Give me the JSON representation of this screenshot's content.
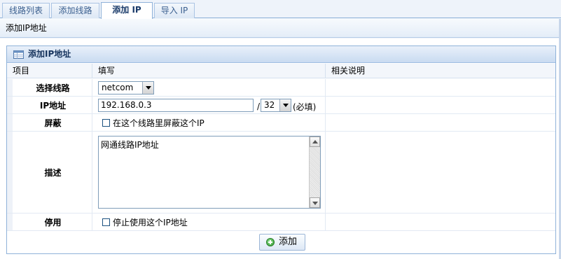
{
  "tabs": [
    {
      "label": "线路列表",
      "active": false
    },
    {
      "label": "添加线路",
      "active": false
    },
    {
      "label": "添加 IP",
      "active": true
    },
    {
      "label": "导入 IP",
      "active": false
    }
  ],
  "header": {
    "title": "添加IP地址"
  },
  "panel": {
    "title": "添加IP地址",
    "columns": [
      "项目",
      "填写",
      "相关说明"
    ]
  },
  "form": {
    "line": {
      "label": "选择线路",
      "value": "netcom"
    },
    "ip": {
      "label": "IP地址",
      "value": "192.168.0.3",
      "separator": "/",
      "mask": "32",
      "required_note": "(必填)"
    },
    "block": {
      "label": "屏蔽",
      "checkbox_label": "在这个线路里屏蔽这个IP",
      "checked": false
    },
    "desc": {
      "label": "描述",
      "value": "网通线路IP地址"
    },
    "disable": {
      "label": "停用",
      "checkbox_label": "停止使用这个IP地址",
      "checked": false
    }
  },
  "actions": {
    "add_label": "添加"
  },
  "colors": {
    "border": "#8fb2d9",
    "title_text": "#15335d",
    "accent": "#2f9a2f"
  }
}
